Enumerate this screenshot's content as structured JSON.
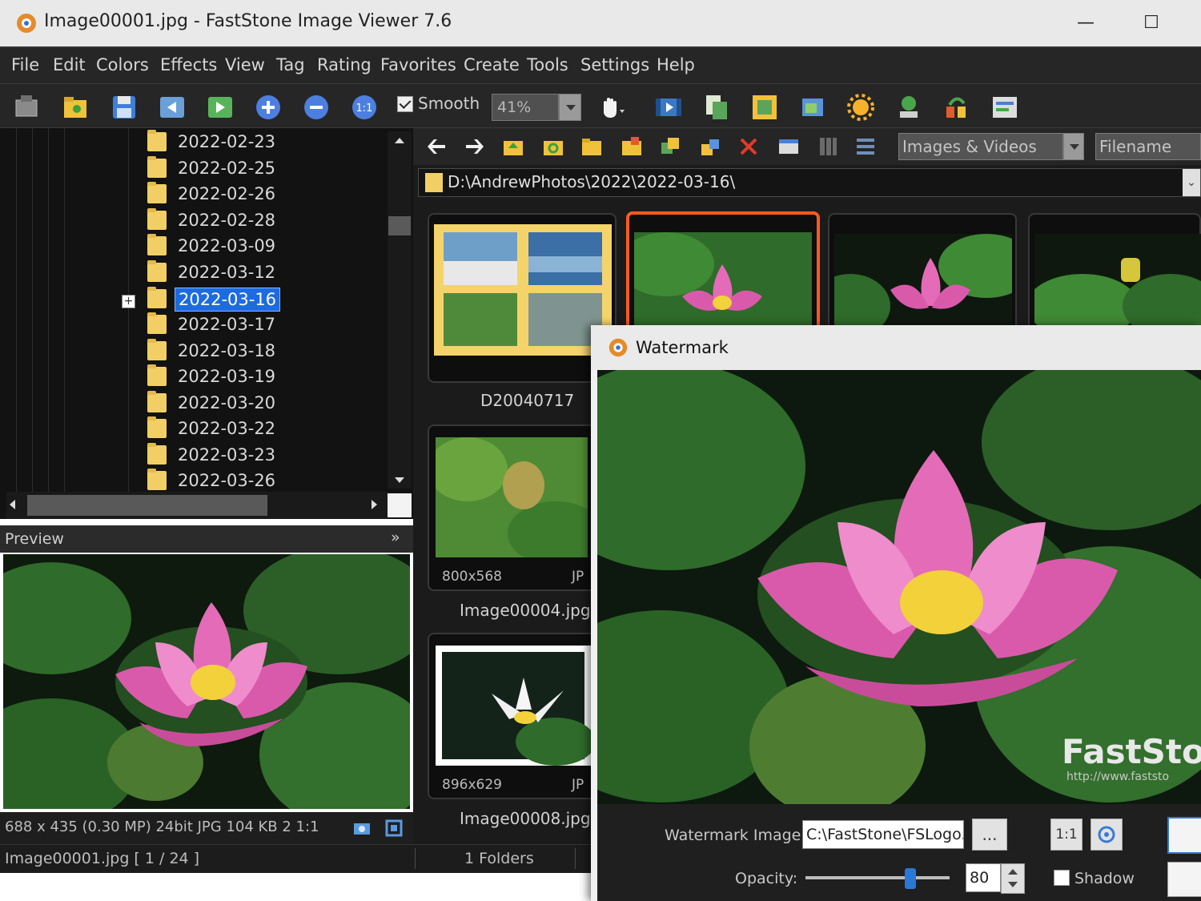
{
  "window": {
    "title": "Image00001.jpg  -  FastStone Image Viewer 7.6",
    "minimize": "—",
    "maximize": "☐"
  },
  "menu": [
    "File",
    "Edit",
    "Colors",
    "Effects",
    "View",
    "Tag",
    "Rating",
    "Favorites",
    "Create",
    "Tools",
    "Settings",
    "Help"
  ],
  "toolbar": {
    "smooth_label": "Smooth",
    "smooth_checked": true,
    "zoom_value": "41%"
  },
  "folder_tree": {
    "items": [
      "2022-02-23",
      "2022-02-25",
      "2022-02-26",
      "2022-02-28",
      "2022-03-09",
      "2022-03-12",
      "2022-03-16",
      "2022-03-17",
      "2022-03-18",
      "2022-03-19",
      "2022-03-20",
      "2022-03-22",
      "2022-03-23",
      "2022-03-26"
    ],
    "selected": "2022-03-16",
    "expand_glyph": "+"
  },
  "preview": {
    "header": "Preview",
    "collapse_glyph": "»",
    "info": "688 x 435 (0.30 MP)  24bit  JPG    104 KB    2  1:1"
  },
  "status": {
    "file": "Image00001.jpg [ 1 / 24 ]",
    "folders": "1 Folders"
  },
  "browser": {
    "filter": "Images & Videos",
    "sort": "Filename",
    "path": "D:\\AndrewPhotos\\2022\\2022-03-16\\",
    "thumbnails": [
      {
        "name": "D20040717",
        "dims": ""
      },
      {
        "name": "",
        "dims": ""
      },
      {
        "name": "",
        "dims": ""
      },
      {
        "name": "",
        "dims": ""
      },
      {
        "name": "Image00004.jpg",
        "dims": "800x568",
        "format": "JP"
      },
      {
        "name": "Image00008.jpg",
        "dims": "896x629",
        "format": "JP"
      }
    ]
  },
  "watermark": {
    "title": "Watermark",
    "image_label": "Watermark Image:",
    "image_path": "C:\\FastStone\\FSLogo.",
    "browse_label": "...",
    "ratio_label": "1:1",
    "opacity_label": "Opacity:",
    "opacity_value": "80",
    "opacity_slider": 0.73,
    "shadow_label": "Shadow",
    "shadow_checked": false,
    "logo_text": "FastSto",
    "logo_url": "http://www.faststo"
  },
  "colors": {
    "accent": "#1d6be0",
    "selection_border": "#ff5a1f",
    "folder": "#f1cf64",
    "dark_bg": "#1b1b1b"
  }
}
